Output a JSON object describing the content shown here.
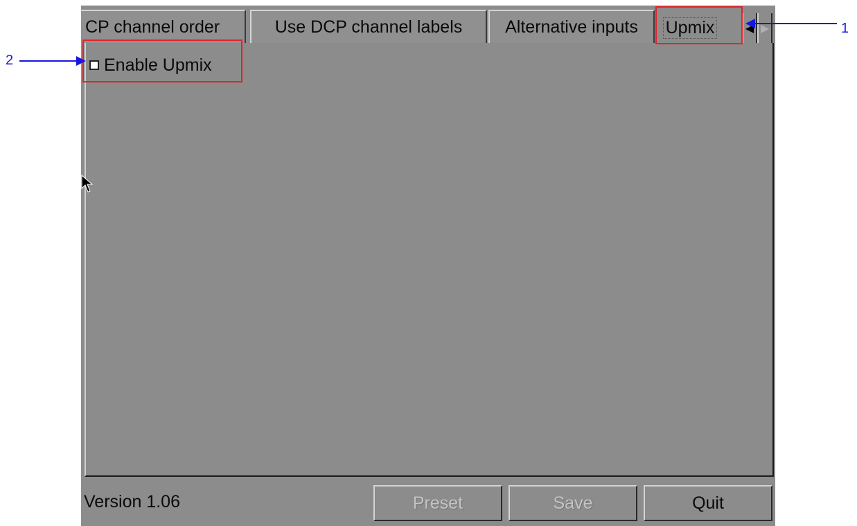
{
  "tabs": [
    {
      "label": "CP channel order"
    },
    {
      "label": "Use DCP channel labels"
    },
    {
      "label": "Alternative inputs"
    },
    {
      "label": "Upmix",
      "active": true
    }
  ],
  "tab_scroll": {
    "left": "◀",
    "right": "▶"
  },
  "upmix": {
    "enable_label": "Enable Upmix",
    "checked": false
  },
  "footer": {
    "version": "Version 1.06",
    "preset_label": "Preset",
    "save_label": "Save",
    "quit_label": "Quit"
  },
  "callouts": [
    {
      "number": "1"
    },
    {
      "number": "2"
    }
  ],
  "colors": {
    "callout_box": "#e0242c",
    "callout_arrow": "#1616e0",
    "panel_bg": "#8c8c8c"
  }
}
